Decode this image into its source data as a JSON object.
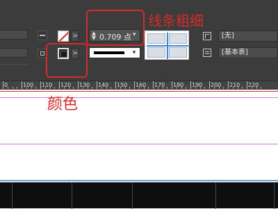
{
  "control_panel": {
    "stroke_weight": {
      "value": "0.709 点",
      "arrows_icon": "stepper-up-down",
      "dropdown_icon": "chevron-down"
    },
    "fill_swatch": "none-swatch",
    "stroke_swatch": "black-stroke-swatch",
    "object_style": "无",
    "table_style": "基本表",
    "right_fields": [
      {
        "label": "[无]"
      },
      {
        "label": "[基本表]"
      }
    ],
    "button_glyph": ">"
  },
  "ruler": {
    "labels": [
      "0",
      "100",
      "110",
      "120",
      "130",
      "140",
      "150",
      "160",
      "170",
      "180",
      "190",
      "200",
      "210",
      "220"
    ]
  },
  "annotations": {
    "stroke_weight_label": "线条粗细",
    "color_label": "颜色",
    "color": "#d52b2b"
  },
  "colors": {
    "panel_bg": "#3c3c3c",
    "guide_red": "#e0203c",
    "guide_magenta": "#d07bd8",
    "grid_blue": "#3a87d9"
  }
}
